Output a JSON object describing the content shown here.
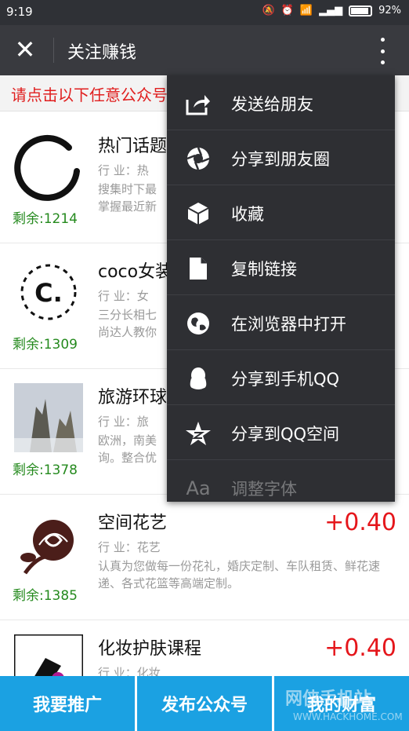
{
  "status_bar": {
    "time": "9:19",
    "battery": "92%"
  },
  "title_bar": {
    "close_icon": "close-icon",
    "title": "关注赚钱",
    "more_icon": "more-vertical-icon"
  },
  "notice": "请点击以下任意公众号",
  "items": [
    {
      "name": "热门话题",
      "industry": "行  业：热",
      "desc": "搜集时下最\n掌握最近新",
      "remaining": "剩余:1214",
      "logo": "ink-circle-logo"
    },
    {
      "name": "coco女装",
      "industry": "行  业：女",
      "desc": "三分长相七\n尚达人教你",
      "remaining": "剩余:1309",
      "logo": "collodi-logo",
      "logo_text": "C."
    },
    {
      "name": "旅游环球",
      "industry": "行  业：旅",
      "desc": "欧洲，南美\n询。整合优",
      "remaining": "剩余:1378",
      "logo": "mountain-landscape-logo"
    },
    {
      "name": "空间花艺",
      "reward": "+0.40",
      "industry": "行  业：花艺",
      "desc": "认真为您做每一份花礼，婚庆定制、车队租赁、鲜花速递、各式花篮等高端定制。",
      "remaining": "剩余:1385",
      "logo": "rose-logo"
    },
    {
      "name": "化妆护肤课程",
      "reward": "+0.40",
      "industry": "行  业：化妆",
      "logo": "makeup-logo"
    }
  ],
  "menu": [
    {
      "label": "发送给朋友",
      "icon": "share-arrow-icon"
    },
    {
      "label": "分享到朋友圈",
      "icon": "moments-aperture-icon"
    },
    {
      "label": "收藏",
      "icon": "cube-favorite-icon"
    },
    {
      "label": "复制链接",
      "icon": "copy-document-icon"
    },
    {
      "label": "在浏览器中打开",
      "icon": "globe-icon"
    },
    {
      "label": "分享到手机QQ",
      "icon": "qq-penguin-icon"
    },
    {
      "label": "分享到QQ空间",
      "icon": "qzone-star-icon"
    },
    {
      "label": "调整字体",
      "icon": "font-size-icon",
      "icon_text": "Aa"
    }
  ],
  "bottom_bar": [
    "我要推广",
    "发布公众号",
    "我的财富"
  ],
  "watermark": {
    "line1": "网侠手机站",
    "line2": "WWW.HACKHOME.COM"
  }
}
